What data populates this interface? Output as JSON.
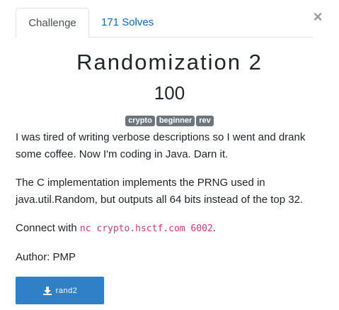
{
  "dialog": {
    "close_glyph": "×"
  },
  "tabs": [
    {
      "label": "Challenge",
      "active": true
    },
    {
      "label": "171 Solves",
      "active": false
    }
  ],
  "challenge": {
    "name": "Randomization 2",
    "value": "100",
    "tags": [
      "crypto",
      "beginner",
      "rev"
    ],
    "description": {
      "paragraph1": "I was tired of writing verbose descriptions so I went and drank some coffee. Now I'm coding in Java. Darn it.",
      "paragraph2": "The C implementation implements the PRNG used in java.util.Random, but outputs all 64 bits instead of the top 32.",
      "connect_prefix": "Connect with ",
      "connect_command": "nc crypto.hsctf.com 6002",
      "connect_suffix": ".",
      "author": "Author: PMP"
    },
    "file_button": {
      "label": "rand2",
      "icon": "download-icon"
    }
  },
  "colors": {
    "tab_link": "#0b6ac9",
    "tag_bg": "#6c757d",
    "button_bg": "#2f80c7",
    "code": "#d6337f"
  }
}
